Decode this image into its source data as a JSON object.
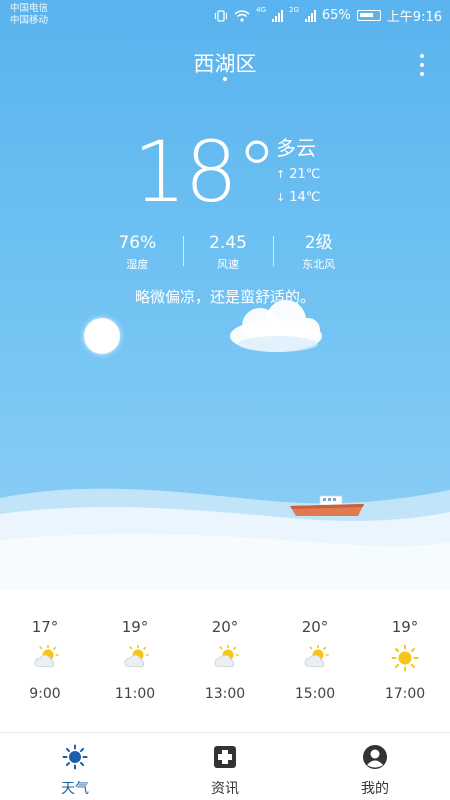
{
  "status_bar": {
    "carrier_1": "中国电信",
    "carrier_2": "中国移动",
    "net_1": "4G",
    "net_2": "2G",
    "battery": "65%",
    "time": "上午9:16"
  },
  "header": {
    "location": "西湖区"
  },
  "current": {
    "temperature": "18°",
    "condition": "多云",
    "high": "21℃",
    "low": "14℃",
    "humidity_value": "76%",
    "humidity_label": "湿度",
    "wind_speed_value": "2.45",
    "wind_speed_label": "风速",
    "wind_level_value": "2级",
    "wind_dir_label": "东北风",
    "description": "略微偏凉，还是蛮舒适的。"
  },
  "hourly": [
    {
      "temp": "17°",
      "time": "9:00",
      "icon": "partly-sunny-icon"
    },
    {
      "temp": "19°",
      "time": "11:00",
      "icon": "partly-sunny-icon"
    },
    {
      "temp": "20°",
      "time": "13:00",
      "icon": "partly-sunny-icon"
    },
    {
      "temp": "20°",
      "time": "15:00",
      "icon": "partly-sunny-icon"
    },
    {
      "temp": "19°",
      "time": "17:00",
      "icon": "sunny-icon"
    }
  ],
  "nav": [
    {
      "label": "天气",
      "icon": "weather-sun-icon",
      "active": true
    },
    {
      "label": "资讯",
      "icon": "news-icon",
      "active": false
    },
    {
      "label": "我的",
      "icon": "profile-icon",
      "active": false
    }
  ],
  "colors": {
    "sky": "#5ab3ee",
    "active_nav": "#1f5ea8",
    "sun": "#f5c518",
    "boat": "#e07a50"
  }
}
